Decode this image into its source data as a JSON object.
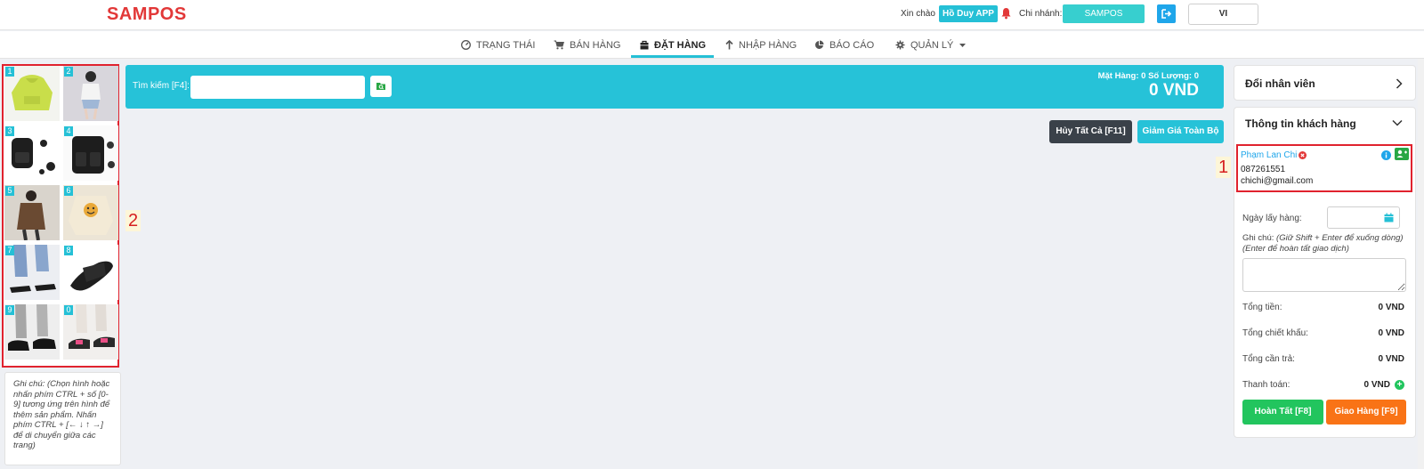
{
  "header": {
    "logo": "SAMPOS",
    "greeting": "Xin chào",
    "user": "Hồ Duy APP",
    "branch_label": "Chi nhánh:",
    "branch": "SAMPOS",
    "language": "VI"
  },
  "nav": {
    "items": [
      {
        "label": "TRẠNG THÁI",
        "icon": "dashboard-icon"
      },
      {
        "label": "BÁN HÀNG",
        "icon": "cart-icon"
      },
      {
        "label": "ĐẶT HÀNG",
        "icon": "bag-icon",
        "active": true
      },
      {
        "label": "NHẬP HÀNG",
        "icon": "arrow-up-icon"
      },
      {
        "label": "BÁO CÁO",
        "icon": "pie-chart-icon"
      },
      {
        "label": "QUẢN LÝ",
        "icon": "gear-icon",
        "has_dropdown": true
      }
    ]
  },
  "products": {
    "items": [
      {
        "num": "1",
        "name": "green-hoodie"
      },
      {
        "num": "2",
        "name": "woman-outfit"
      },
      {
        "num": "3",
        "name": "black-backpack"
      },
      {
        "num": "4",
        "name": "black-backpack-pockets"
      },
      {
        "num": "5",
        "name": "brown-jacket-model"
      },
      {
        "num": "6",
        "name": "smiley-hoodie"
      },
      {
        "num": "7",
        "name": "heeled-sandals"
      },
      {
        "num": "8",
        "name": "black-slide"
      },
      {
        "num": "9",
        "name": "black-loafers"
      },
      {
        "num": "0",
        "name": "pink-sneakers"
      }
    ],
    "hint": "Ghi chú: (Chọn hình hoặc nhấn phím CTRL + số [0-9] tương ứng trên hình để thêm sản phẩm. Nhấn phím CTRL + [← ↓ ↑ →] để di chuyển giữa các trang)"
  },
  "annotations": {
    "left": "2",
    "right": "1"
  },
  "search": {
    "label": "Tìm kiếm [F4]:",
    "value": "",
    "count_text": "Mặt Hàng:  0  Số Lượng:  0",
    "total": "0 VND"
  },
  "actions": {
    "cancel_all": "Hủy Tất Cả [F11]",
    "discount_all": "Giảm Giá Toàn Bộ"
  },
  "right_panel": {
    "change_staff": "Đổi nhân viên",
    "customer_info": "Thông tin khách hàng",
    "customer": {
      "name": "Phạm Lan Chi",
      "phone": "087261551",
      "email": "chichi@gmail.com"
    },
    "pickup_date_label": "Ngày lấy hàng:",
    "pickup_date_value": "",
    "note_label": "Ghi chú:",
    "note_hint": "(Giữ Shift + Enter để xuống dòng) (Enter để hoàn tất giao dịch)",
    "note_value": "",
    "summary": [
      {
        "label": "Tổng tiền:",
        "value": "0 VND"
      },
      {
        "label": "Tổng chiết khấu:",
        "value": "0 VND"
      },
      {
        "label": "Tổng cần trả:",
        "value": "0 VND"
      },
      {
        "label": "Thanh toán:",
        "value": "0 VND"
      }
    ],
    "complete_button": "Hoàn Tất [F8]",
    "delivery_button": "Giao Hàng [F9]"
  },
  "colors": {
    "brand": "#e23838",
    "accent": "#25c0d6",
    "annotation": "#e0222e",
    "success": "#22c55e",
    "warning": "#f97316"
  }
}
